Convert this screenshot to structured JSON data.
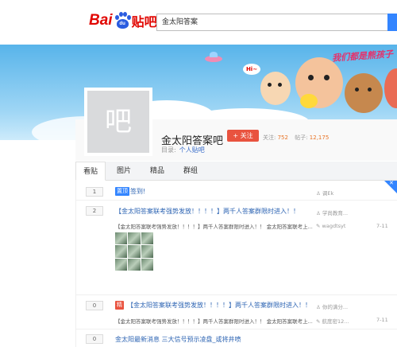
{
  "header": {
    "logo_bai": "Bai",
    "logo_du": "du",
    "logo_tieba": "贴吧",
    "search_value": "金太阳答案"
  },
  "banner": {
    "slogan": "我们都是熊孩子",
    "bubble": "Hi~"
  },
  "forum": {
    "avatar_text": "吧",
    "title": "金太阳答案吧",
    "follow_label": "+ 关注",
    "follow_count_label": "关注:",
    "follow_count": "752",
    "post_count_label": "帖子:",
    "post_count": "12,175",
    "category_label": "目录:",
    "category_link": "个人贴吧"
  },
  "tabs": [
    "看贴",
    "图片",
    "精品",
    "群组"
  ],
  "threads": [
    {
      "replies": "1",
      "tag": "置顶",
      "title": "签到!",
      "author": "调Ek"
    },
    {
      "replies": "2",
      "title": "【金太阳答案联考强势发放！！！！】两千人答案群限时进入！！",
      "excerpt": "【金太阳答案联考强势发放！！！！】两千人答案群限时进入！！ 金太阳答案联考上...",
      "author": "学尚教育...",
      "last_reply": "wagdtsyt",
      "time": "7-11"
    },
    {
      "replies": "0",
      "tag": "精",
      "title": "【金太阳答案联考强势发放！！！！】两千人答案群限时进入！！",
      "excerpt": "【金太阳答案联考强势发放！！！！】两千人答案群限时进入！！ 金太阳答案联考上...",
      "author": "你的满分...",
      "last_reply": "航度密12...",
      "time": "7-11"
    },
    {
      "replies": "0",
      "title": "金太阳最新消息 三大信号预示凌盘_或将井喷"
    }
  ],
  "colors": {
    "brand_red": "#e10601",
    "brand_blue": "#2a5ce0",
    "link": "#2d64b3",
    "follow_button": "#e9533f",
    "top_tag": "#3385ff"
  }
}
